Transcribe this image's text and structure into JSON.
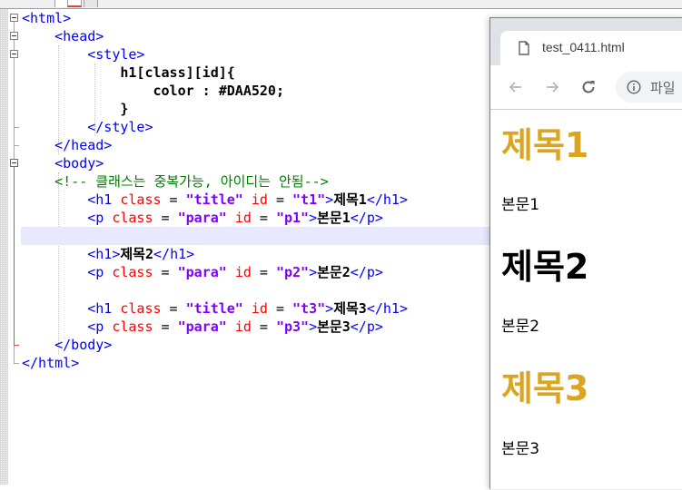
{
  "editor": {
    "lines": [
      [
        {
          "t": "tag",
          "v": "<html>"
        }
      ],
      [
        {
          "t": "sp",
          "v": "    "
        },
        {
          "t": "tag",
          "v": "<head>"
        }
      ],
      [
        {
          "t": "sp",
          "v": "        "
        },
        {
          "t": "tag",
          "v": "<style>"
        }
      ],
      [
        {
          "t": "sp",
          "v": "            "
        },
        {
          "t": "txt",
          "v": "h1[class][id]{"
        }
      ],
      [
        {
          "t": "sp",
          "v": "                "
        },
        {
          "t": "txt",
          "v": "color : #DAA520;"
        }
      ],
      [
        {
          "t": "sp",
          "v": "            "
        },
        {
          "t": "txt",
          "v": "}"
        }
      ],
      [
        {
          "t": "sp",
          "v": "        "
        },
        {
          "t": "tag",
          "v": "</style>"
        }
      ],
      [
        {
          "t": "sp",
          "v": "    "
        },
        {
          "t": "tag",
          "v": "</head>"
        }
      ],
      [
        {
          "t": "sp",
          "v": "    "
        },
        {
          "t": "tag",
          "v": "<body>"
        }
      ],
      [
        {
          "t": "sp",
          "v": "    "
        },
        {
          "t": "cmt",
          "v": "<!-- 클래스는 중복가능, 아이디는 안됨-->"
        }
      ],
      [
        {
          "t": "sp",
          "v": "        "
        },
        {
          "t": "tag",
          "v": "<h1 "
        },
        {
          "t": "attr",
          "v": "class"
        },
        {
          "t": "plain",
          "v": " = "
        },
        {
          "t": "str",
          "v": "\"title\""
        },
        {
          "t": "plain",
          "v": " "
        },
        {
          "t": "attr",
          "v": "id"
        },
        {
          "t": "plain",
          "v": " = "
        },
        {
          "t": "str",
          "v": "\"t1\""
        },
        {
          "t": "tag",
          "v": ">"
        },
        {
          "t": "txt",
          "v": "제목1"
        },
        {
          "t": "tag",
          "v": "</h1>"
        }
      ],
      [
        {
          "t": "sp",
          "v": "        "
        },
        {
          "t": "tag",
          "v": "<p "
        },
        {
          "t": "attr",
          "v": "class"
        },
        {
          "t": "plain",
          "v": " = "
        },
        {
          "t": "str",
          "v": "\"para\""
        },
        {
          "t": "plain",
          "v": " "
        },
        {
          "t": "attr",
          "v": "id"
        },
        {
          "t": "plain",
          "v": " = "
        },
        {
          "t": "str",
          "v": "\"p1\""
        },
        {
          "t": "tag",
          "v": ">"
        },
        {
          "t": "txt",
          "v": "본문1"
        },
        {
          "t": "tag",
          "v": "</p>"
        }
      ],
      [],
      [
        {
          "t": "sp",
          "v": "        "
        },
        {
          "t": "tag",
          "v": "<h1>"
        },
        {
          "t": "txt",
          "v": "제목2"
        },
        {
          "t": "tag",
          "v": "</h1>"
        }
      ],
      [
        {
          "t": "sp",
          "v": "        "
        },
        {
          "t": "tag",
          "v": "<p "
        },
        {
          "t": "attr",
          "v": "class"
        },
        {
          "t": "plain",
          "v": " = "
        },
        {
          "t": "str",
          "v": "\"para\""
        },
        {
          "t": "plain",
          "v": " "
        },
        {
          "t": "attr",
          "v": "id"
        },
        {
          "t": "plain",
          "v": " = "
        },
        {
          "t": "str",
          "v": "\"p2\""
        },
        {
          "t": "tag",
          "v": ">"
        },
        {
          "t": "txt",
          "v": "본문2"
        },
        {
          "t": "tag",
          "v": "</p>"
        }
      ],
      [],
      [
        {
          "t": "sp",
          "v": "        "
        },
        {
          "t": "tag",
          "v": "<h1 "
        },
        {
          "t": "attr",
          "v": "class"
        },
        {
          "t": "plain",
          "v": " = "
        },
        {
          "t": "str",
          "v": "\"title\""
        },
        {
          "t": "plain",
          "v": " "
        },
        {
          "t": "attr",
          "v": "id"
        },
        {
          "t": "plain",
          "v": " = "
        },
        {
          "t": "str",
          "v": "\"t3\""
        },
        {
          "t": "tag",
          "v": ">"
        },
        {
          "t": "txt",
          "v": "제목3"
        },
        {
          "t": "tag",
          "v": "</h1>"
        }
      ],
      [
        {
          "t": "sp",
          "v": "        "
        },
        {
          "t": "tag",
          "v": "<p "
        },
        {
          "t": "attr",
          "v": "class"
        },
        {
          "t": "plain",
          "v": " = "
        },
        {
          "t": "str",
          "v": "\"para\""
        },
        {
          "t": "plain",
          "v": " "
        },
        {
          "t": "attr",
          "v": "id"
        },
        {
          "t": "plain",
          "v": " = "
        },
        {
          "t": "str",
          "v": "\"p3\""
        },
        {
          "t": "tag",
          "v": ">"
        },
        {
          "t": "txt",
          "v": "본문3"
        },
        {
          "t": "tag",
          "v": "</p>"
        }
      ],
      [
        {
          "t": "sp",
          "v": "    "
        },
        {
          "t": "tag",
          "v": "</body>"
        }
      ],
      [
        {
          "t": "tag",
          "v": "</html>"
        }
      ]
    ]
  },
  "browser": {
    "tab_title": "test_0411.html",
    "omnibox_text": "파일",
    "content": {
      "h1_1": "제목1",
      "p_1": "본문1",
      "h1_2": "제목2",
      "p_2": "본문2",
      "h1_3": "제목3",
      "p_3": "본문3"
    }
  },
  "colors": {
    "heading_gold": "#DAA520",
    "tag_blue": "#0000ff",
    "attr_red": "#ff0000",
    "string_purple": "#8000ff",
    "comment_green": "#008000"
  },
  "icons": {
    "tab": "document-icon",
    "back": "back-arrow-icon",
    "forward": "forward-arrow-icon",
    "reload": "reload-icon",
    "site_info": "info-icon"
  }
}
